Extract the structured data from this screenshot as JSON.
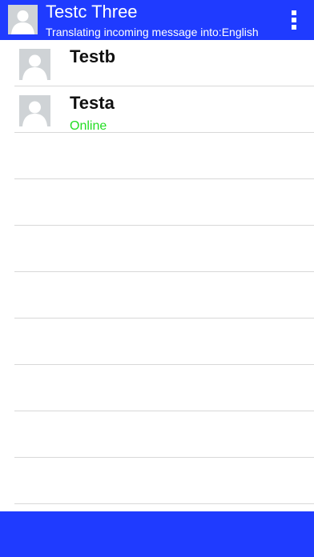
{
  "header": {
    "title": "Testc Three",
    "subtitle": "Translating incoming message into:English",
    "avatar_icon": "person-silhouette-icon",
    "menu_icon": "vertical-dots-icon",
    "background_color": "#1f3bff"
  },
  "contacts": [
    {
      "name": "Testb",
      "status": "",
      "avatar_icon": "person-silhouette-icon"
    },
    {
      "name": "Testa",
      "status": "Online",
      "status_color": "#22dd22",
      "avatar_icon": "person-silhouette-icon"
    }
  ],
  "footer": {
    "background_color": "#1f3bff"
  }
}
